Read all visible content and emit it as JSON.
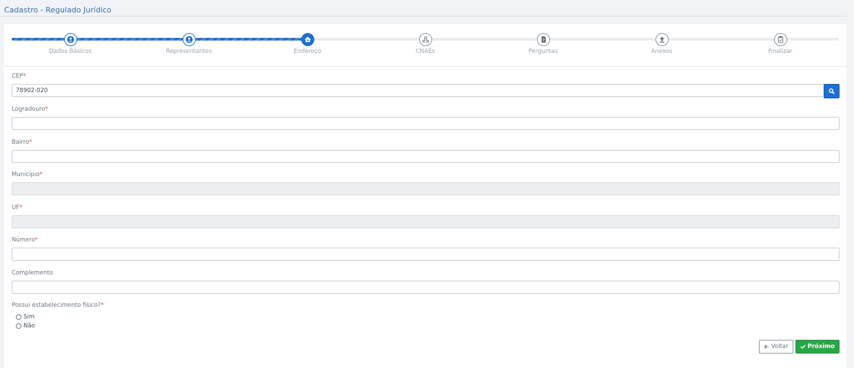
{
  "page": {
    "title": "Cadastro - Regulado Jurídico"
  },
  "stepper": {
    "progress": 0.357,
    "steps": [
      {
        "label": "Dados Básicos",
        "icon": "user-icon",
        "state": "done"
      },
      {
        "label": "Representantes",
        "icon": "user-icon",
        "state": "done"
      },
      {
        "label": "Endereço",
        "icon": "home-icon",
        "state": "active"
      },
      {
        "label": "CNAEs",
        "icon": "sitemap-icon",
        "state": "pending"
      },
      {
        "label": "Perguntas",
        "icon": "question-file-icon",
        "state": "pending"
      },
      {
        "label": "Anexos",
        "icon": "upload-icon",
        "state": "pending"
      },
      {
        "label": "Finalizar",
        "icon": "clipboard-check-icon",
        "state": "pending"
      }
    ]
  },
  "form": {
    "required_mark": "*",
    "cep": {
      "label": "CEP",
      "value": "78902-020"
    },
    "logradouro": {
      "label": "Logradouro",
      "value": ""
    },
    "bairro": {
      "label": "Bairro",
      "value": ""
    },
    "municipio": {
      "label": "Município",
      "value": ""
    },
    "uf": {
      "label": "UF",
      "value": ""
    },
    "numero": {
      "label": "Número",
      "value": ""
    },
    "complemento": {
      "label": "Complemento",
      "value": ""
    },
    "estabelecimento": {
      "label": "Possui estabelecimento físico?",
      "options": [
        "Sim",
        "Não"
      ]
    }
  },
  "actions": {
    "back_label": "Voltar",
    "next_label": "Próximo"
  },
  "colors": {
    "primary": "#1d6fd1",
    "success": "#28a745",
    "required": "#d9534f",
    "title": "#3a6fa8"
  }
}
